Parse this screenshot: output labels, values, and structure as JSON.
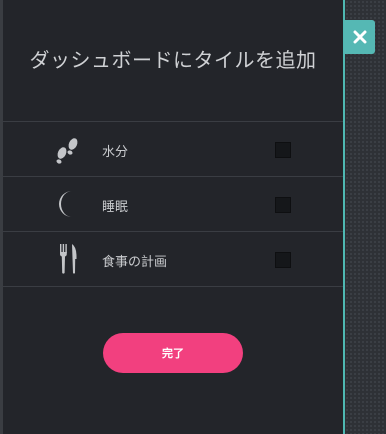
{
  "dialog": {
    "title": "ダッシュボードにタイルを追加",
    "close_icon": "close-icon",
    "done_label": "完了"
  },
  "tiles": [
    {
      "label": "水分",
      "icon": "footprints-icon",
      "checked": false
    },
    {
      "label": "睡眠",
      "icon": "moon-icon",
      "checked": false
    },
    {
      "label": "食事の計画",
      "icon": "fork-knife-icon",
      "checked": false
    }
  ],
  "colors": {
    "accent": "#55b8b4",
    "primary_button": "#f2407f",
    "panel_background": "#23252a"
  }
}
